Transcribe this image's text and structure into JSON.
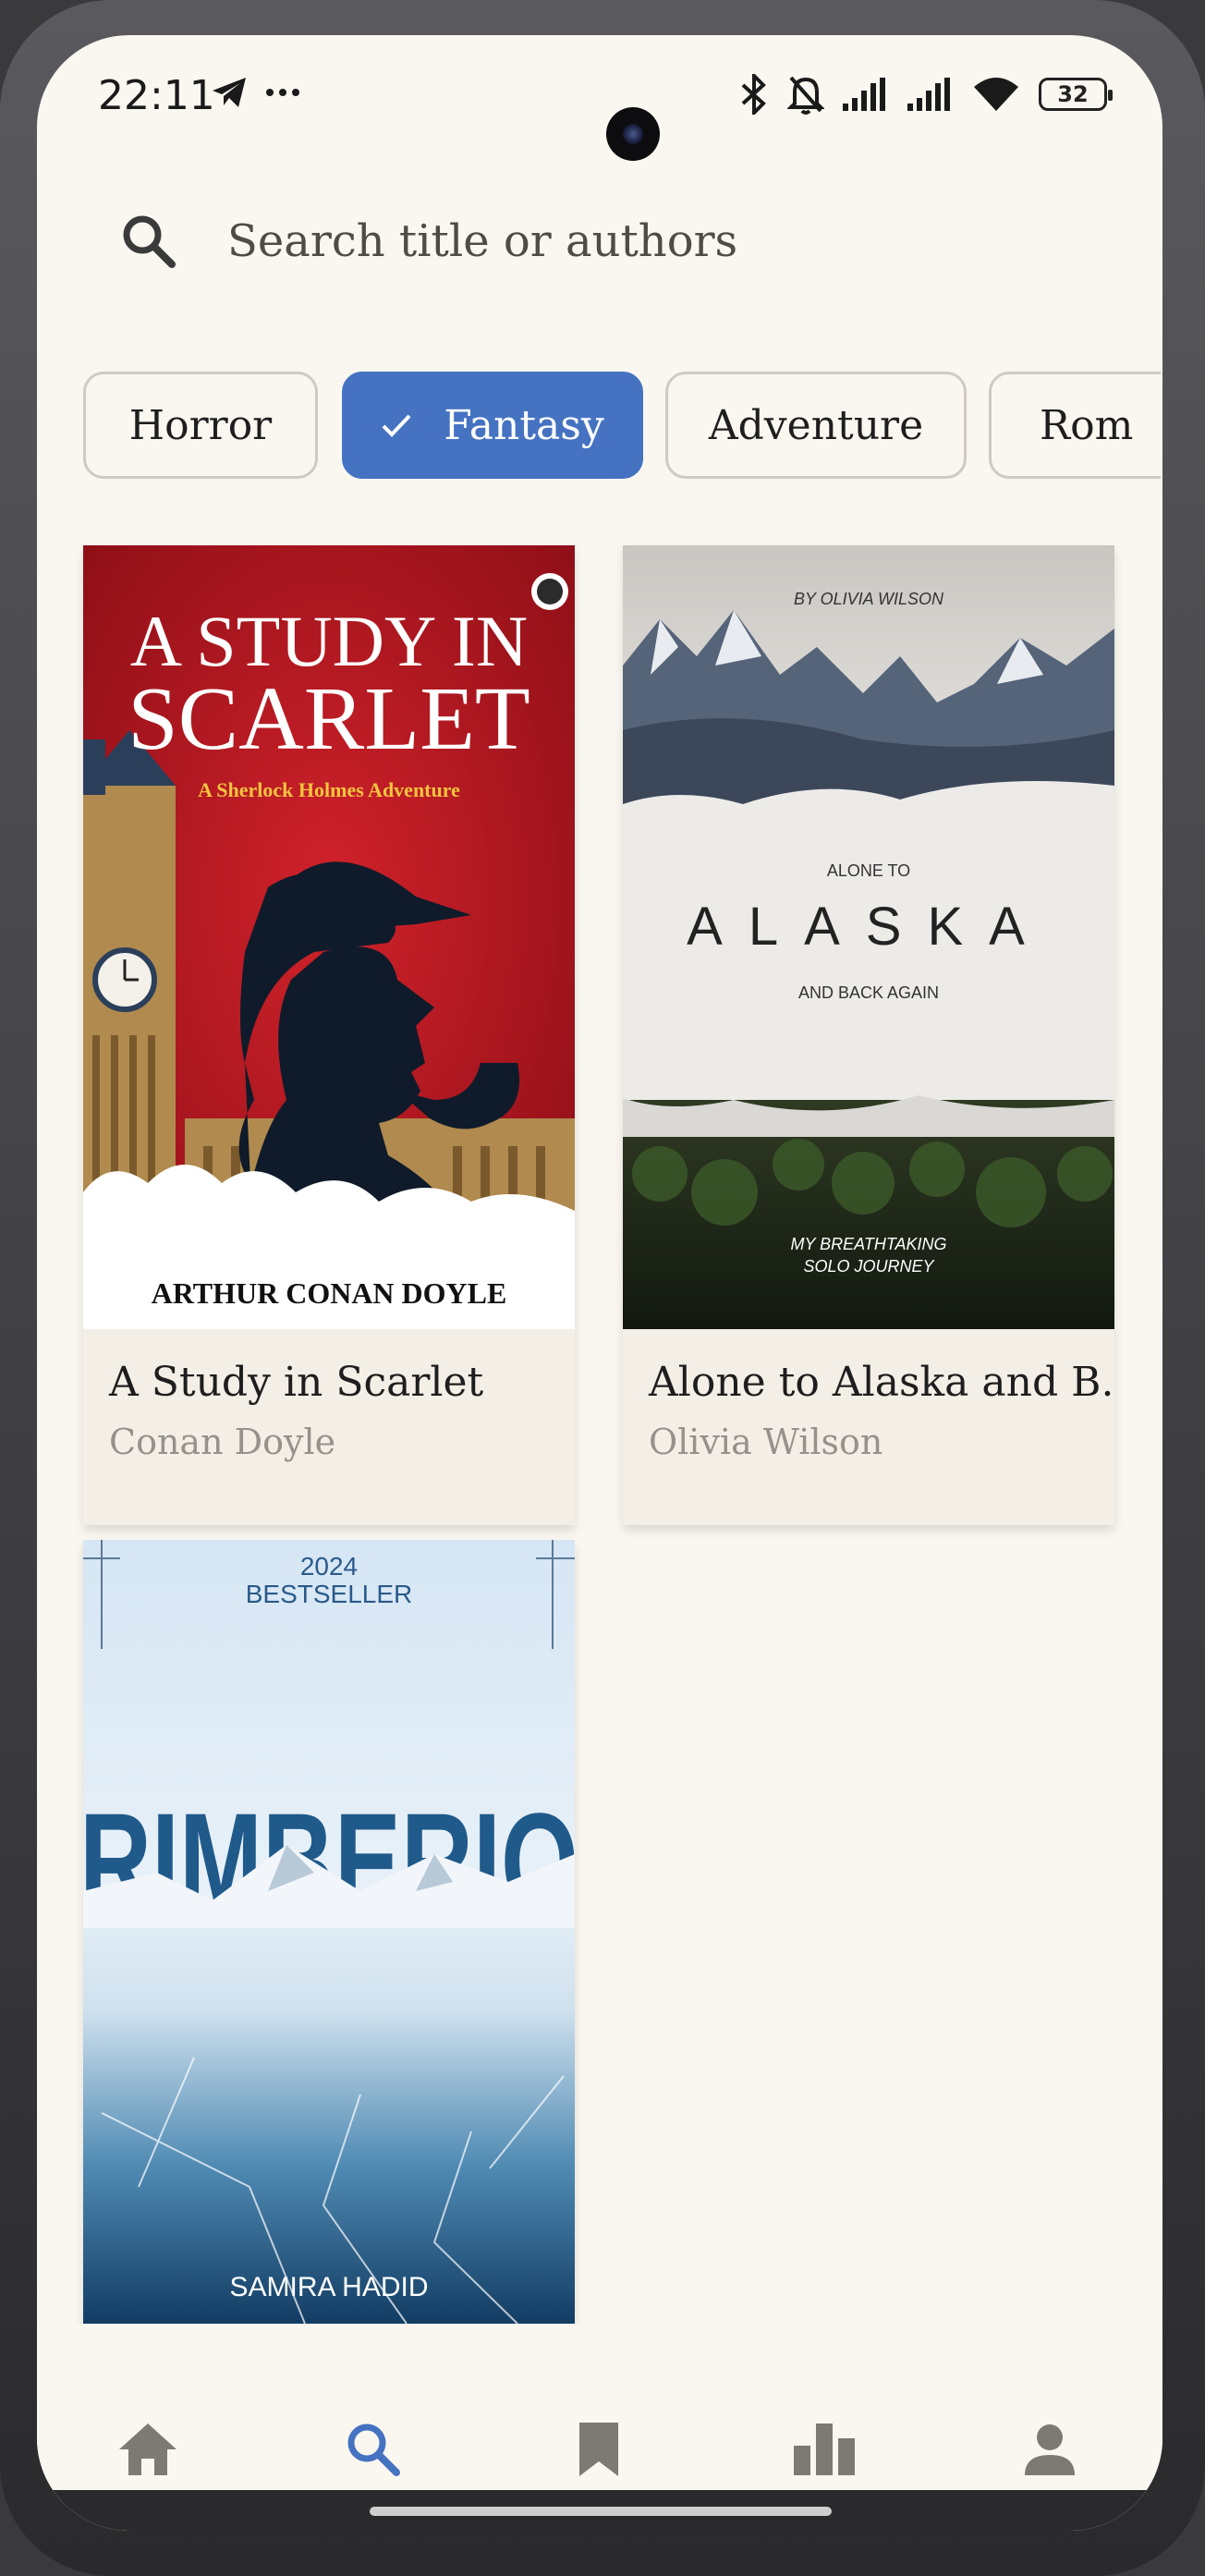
{
  "status_bar": {
    "time": "22:11",
    "battery": "32",
    "left_icons": [
      "telegram-icon",
      "more-dots-icon"
    ],
    "right_icons": [
      "bluetooth-icon",
      "bell-muted-icon",
      "signal-icon",
      "signal-icon",
      "wifi-icon",
      "battery-icon"
    ]
  },
  "search": {
    "placeholder": "Search title or authors"
  },
  "genres": [
    {
      "label": "Horror",
      "selected": false
    },
    {
      "label": "Fantasy",
      "selected": true
    },
    {
      "label": "Adventure",
      "selected": false
    },
    {
      "label": "Rom",
      "selected": false
    }
  ],
  "books": [
    {
      "title": "A Study in Scarlet",
      "author": "Conan Doyle",
      "cover": {
        "title_line1": "A STUDY IN",
        "title_line2": "SCARLET",
        "subtitle": "A Sherlock Holmes Adventure",
        "author": "ARTHUR CONAN DOYLE",
        "colors": [
          "#b3121c",
          "#0f1b2a"
        ]
      }
    },
    {
      "title": "Alone to Alaska and B...",
      "author": "Olivia Wilson",
      "cover": {
        "byline": "BY OLIVIA WILSON",
        "pre": "ALONE TO",
        "main": "ALASKA",
        "post": "AND BACK AGAIN",
        "tag_line1": "MY BREATHTAKING",
        "tag_line2": "SOLO JOURNEY"
      }
    },
    {
      "title": "",
      "author": "",
      "cover": {
        "year": "2024",
        "badge": "BESTSELLER",
        "main": "RIMBERIO",
        "author": "SAMIRA HADID"
      }
    }
  ],
  "bottom_nav": [
    {
      "icon": "home-icon",
      "active": false
    },
    {
      "icon": "search-icon",
      "active": true
    },
    {
      "icon": "bookmark-icon",
      "active": false
    },
    {
      "icon": "stats-icon",
      "active": false
    },
    {
      "icon": "profile-icon",
      "active": false
    }
  ],
  "colors": {
    "accent": "#4573c2",
    "background": "#faf7f0",
    "nav_inactive": "#7d7a76"
  }
}
